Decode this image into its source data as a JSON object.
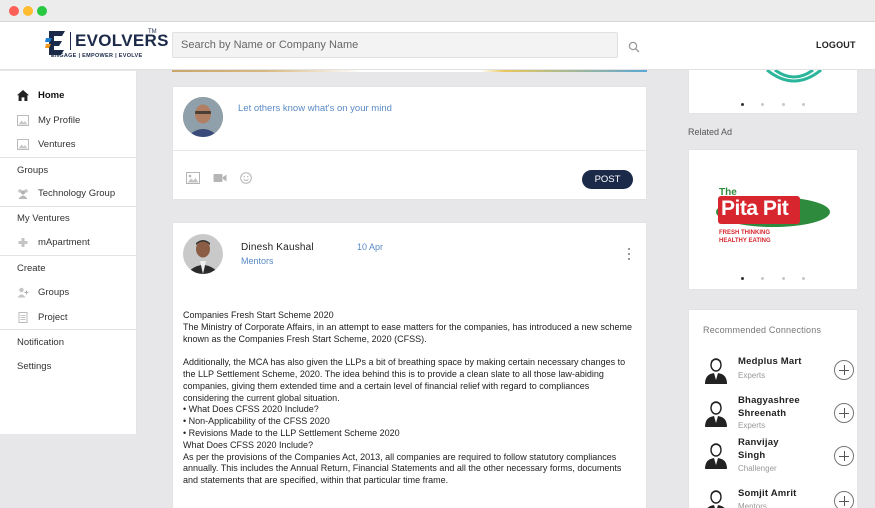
{
  "window": {
    "controls": [
      "close",
      "minimize",
      "maximize"
    ]
  },
  "header": {
    "logo_word": "EVOLVERS",
    "logo_tm": "TM",
    "logo_tagline": "ENGAGE | EMPOWER | EVOLVE",
    "search_placeholder": "Search by Name or Company Name",
    "logout_label": "LOGOUT"
  },
  "sidebar": {
    "home": "Home",
    "my_profile": "My Profile",
    "ventures": "Ventures",
    "groups_heading": "Groups",
    "technology_group": "Technology Group",
    "my_ventures_heading": "My Ventures",
    "mapartment": "mApartment",
    "create_heading": "Create",
    "create_groups": "Groups",
    "create_project": "Project",
    "notification": "Notification",
    "settings": "Settings"
  },
  "composer": {
    "placeholder": "Let others know what's on your mind",
    "post_label": "POST",
    "tool_icons": [
      "image-icon",
      "video-icon",
      "emoji-icon"
    ]
  },
  "post": {
    "author": "Dinesh Kaushal",
    "role": "Mentors",
    "date": "10 Apr",
    "body_1": "Companies Fresh Start Scheme 2020\nThe Ministry of Corporate Affairs, in an attempt to ease matters for the companies, has introduced a new scheme known as the Companies Fresh Start Scheme, 2020 (CFSS).",
    "body_2": "Additionally, the MCA has also given the LLPs a bit of breathing space by making certain necessary changes to the LLP Settlement Scheme, 2020. The idea behind this is to provide a clean slate to all those law-abiding companies, giving them extended time and a certain level of financial relief with regard to compliances considering the current global situation.\n• What Does CFSS 2020 Include?\n• Non-Applicability of the CFSS 2020\n• Revisions Made to the LLP Settlement Scheme 2020\nWhat Does CFSS 2020 Include?\nAs per the provisions of the Companies Act, 2013, all companies are required to follow statutory compliances annually. This includes the Annual Return, Financial Statements and all the other necessary forms, documents and statements that are specified, within that particular time frame."
  },
  "right": {
    "related_ad_label": "Related Ad",
    "ad_brand_top": "The",
    "ad_brand_main": "Pita Pit",
    "ad_tagline_1": "FRESH THINKING",
    "ad_tagline_2": "HEALTHY EATING",
    "carousel_count": 4,
    "carousel_active": 1,
    "recommended_title": "Recommended Connections",
    "connections": [
      {
        "name_1": "Medplus Mart",
        "name_2": "",
        "role": "Experts"
      },
      {
        "name_1": "Bhagyashree",
        "name_2": "Shreenath",
        "role": "Experts"
      },
      {
        "name_1": "Ranvijay",
        "name_2": "Singh",
        "role": "Challenger"
      },
      {
        "name_1": "Somjit Amrit",
        "name_2": "",
        "role": "Mentors"
      }
    ]
  },
  "colors": {
    "brand_navy": "#1c2a4a",
    "link_blue": "#5a8ac6",
    "ad_green": "#2e8b3d",
    "ad_red": "#d7262e",
    "teal_accent": "#2bb59a"
  }
}
